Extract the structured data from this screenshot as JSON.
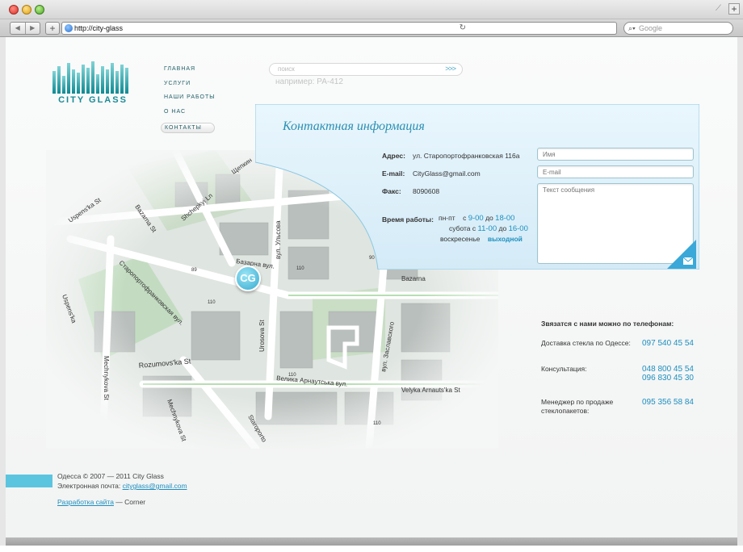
{
  "browser": {
    "url": "http://city-glass",
    "search_placeholder": "Google",
    "new_tab": "+",
    "add_bookmark": "+",
    "back": "◀",
    "forward": "▶"
  },
  "logo": {
    "text": "CITY GLASS"
  },
  "nav": {
    "items": [
      {
        "label": "ГЛАВНАЯ"
      },
      {
        "label": "УСЛУГИ"
      },
      {
        "label": "НАШИ РАБОТЫ"
      },
      {
        "label": "О НАС"
      },
      {
        "label": "КОНТАКТЫ"
      }
    ]
  },
  "site_search": {
    "placeholder": "поиск",
    "example": "например: РА-412",
    "go": ">>>"
  },
  "map": {
    "pin": "CG",
    "labels": [
      {
        "text": "Щепкин"
      },
      {
        "text": "Shchepkyi Ln"
      },
      {
        "text": "Bazarna St"
      },
      {
        "text": "Uspens'ka St"
      },
      {
        "text": "Старопортофранковская вул."
      },
      {
        "text": "Mechnykova St"
      },
      {
        "text": "Базарна вул."
      },
      {
        "text": "вул. Ульсова"
      },
      {
        "text": "Urosova St"
      },
      {
        "text": "Rozumovs'ka St"
      },
      {
        "text": "Велика Арнаутська вул."
      },
      {
        "text": "Velyka Arnauts'ka St"
      },
      {
        "text": "вул. Заславского"
      },
      {
        "text": "Bazarna"
      },
      {
        "text": "Mechnykova St"
      },
      {
        "text": "Staroporto"
      },
      {
        "text": "Uspens'ka"
      }
    ],
    "numbers": [
      "89",
      "110",
      "110",
      "110",
      "90",
      "110"
    ]
  },
  "contact": {
    "title": "Контактная информация",
    "address_label": "Адрес:",
    "address": "ул. Старопортофранковская 116а",
    "email_label": "E-mail:",
    "email": "CityGlass@gmail.com",
    "fax_label": "Факс:",
    "fax": "8090608",
    "hours_label": "Время работы:",
    "hours": {
      "row1_day": "пн-пт",
      "row1_from": "с",
      "row1_t1": "9-00",
      "row1_to": "до",
      "row1_t2": "18-00",
      "row2_day": "субота с",
      "row2_t1": "11-00",
      "row2_to": "до",
      "row2_t2": "16-00",
      "row3_day": "воскресенье",
      "row3_val": "выходной"
    },
    "form": {
      "name_placeholder": "Имя",
      "email_placeholder": "E-mail",
      "message_placeholder": "Текст сообщения"
    }
  },
  "phones": {
    "heading": "Звязатся с нами можно по телефонам:",
    "rows": [
      {
        "label": "Доставка стекла по Одессе:",
        "numbers": [
          "097 540 45 54"
        ]
      },
      {
        "label": "Консультация:",
        "numbers": [
          "048 800 45 54",
          "096 830 45 30"
        ]
      },
      {
        "label": "Менеджер по продаже стеклопакетов:",
        "numbers": [
          "095 356 58 84"
        ]
      }
    ]
  },
  "footer": {
    "copyright": "Одесса © 2007 — 2011  City Glass",
    "email_label": "Электронная почта: ",
    "email": "cityglass@gmail.com",
    "dev_link": "Разработка сайта",
    "dev_sep": " — ",
    "dev_name": "Corner"
  },
  "colors": {
    "accent": "#1d8fbf",
    "brand": "#1a8b96",
    "panel": "#dff1fb",
    "footer_bar": "#5bc5e0"
  }
}
